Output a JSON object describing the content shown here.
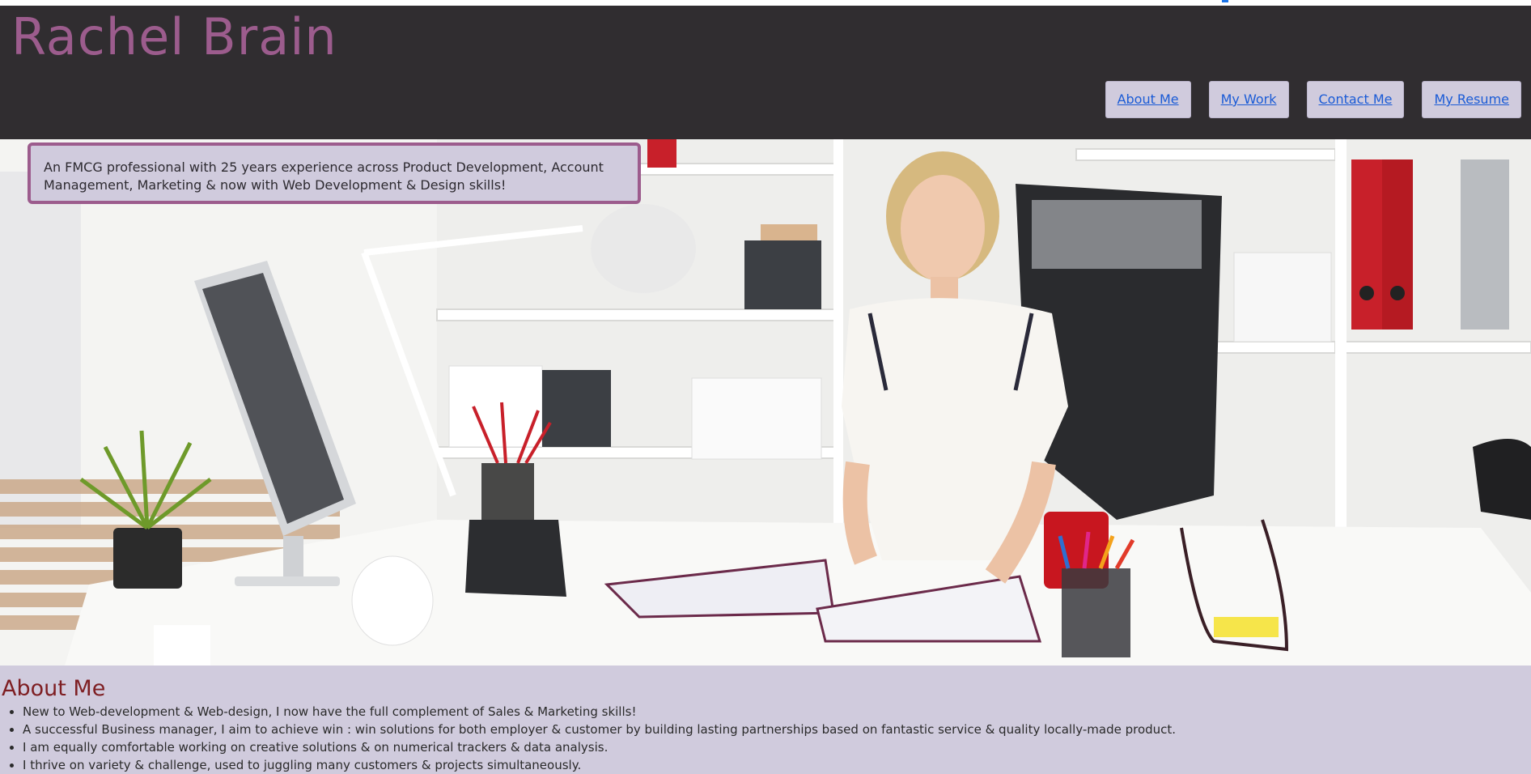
{
  "header": {
    "title": "Rachel Brain"
  },
  "nav": [
    {
      "label": "About Me"
    },
    {
      "label": "My Work"
    },
    {
      "label": "Contact Me"
    },
    {
      "label": "My Resume"
    }
  ],
  "hero": {
    "tagline": "An FMCG professional with 25 years experience across Product Development, Account Management, Marketing & now with Web Development & Design skills!",
    "image_alt": "woman at office desk"
  },
  "about": {
    "heading": "About Me",
    "items": [
      "New to Web-development & Web-design, I now have the full complement of Sales & Marketing skills!",
      "A successful Business manager, I aim to achieve win : win solutions for both employer & customer by building lasting partnerships based on fantastic service & quality locally-made product.",
      "I am equally comfortable working on creative solutions & on numerical trackers & data analysis.",
      "I thrive on variety & challenge, used to juggling many customers & projects simultaneously."
    ]
  },
  "colors": {
    "header_bg": "#302d30",
    "title": "#9c5c8d",
    "page_bg": "#d0cbdd",
    "heading": "#7e1e22",
    "link": "#1a5bd6"
  }
}
